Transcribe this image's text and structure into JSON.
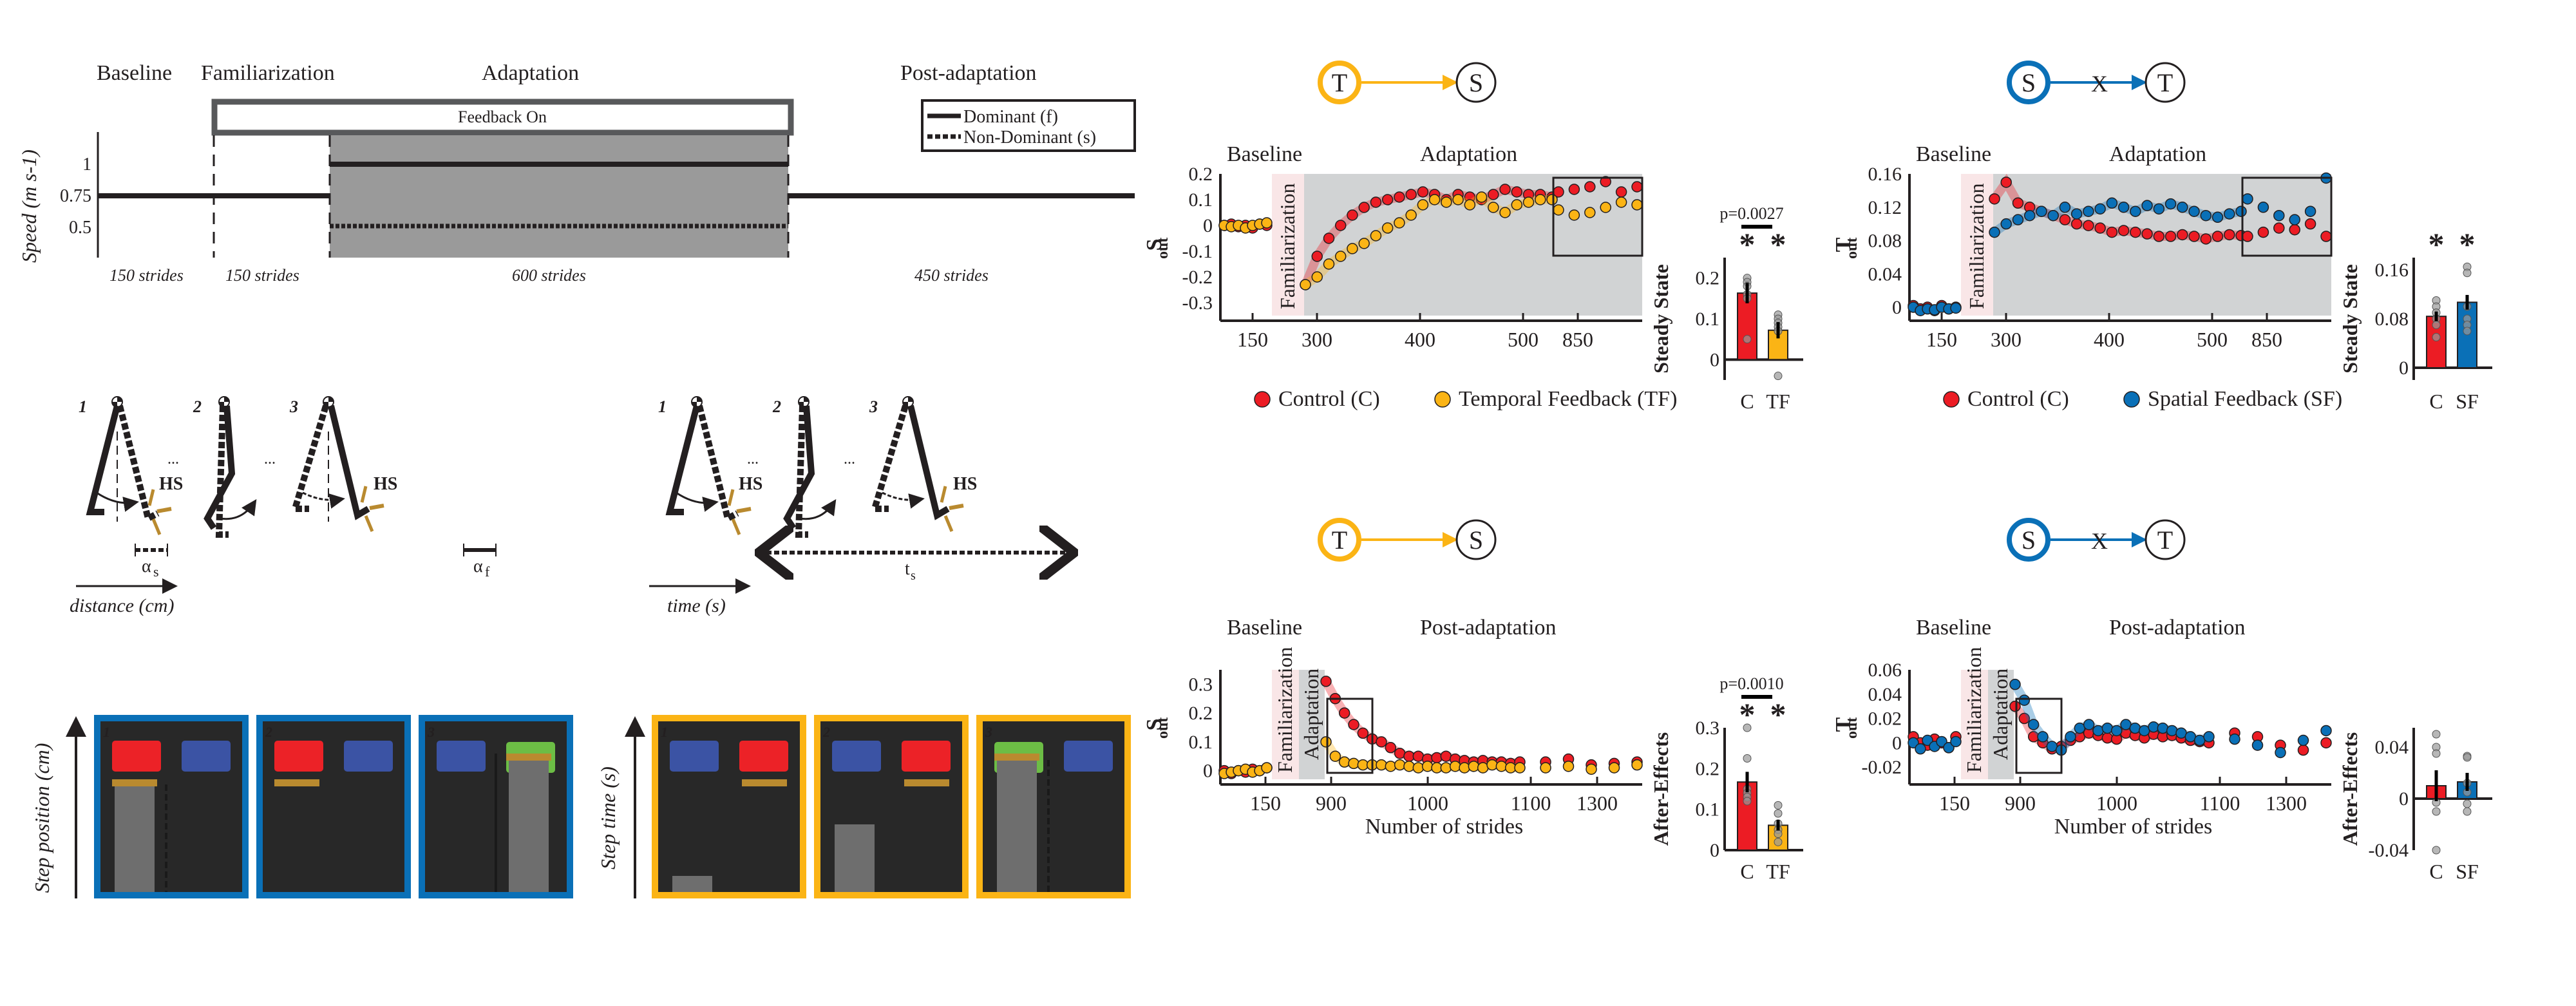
{
  "colors": {
    "control": "#ec1c24",
    "temporal": "#fbb415",
    "spatial": "#0a70b7",
    "hs": "#b98a2f",
    "familiarization_shade": "#f9e6e7",
    "adaptation_shade": "#d1d3d4",
    "screen_bg": "#282828",
    "screen_bar": "#6e6e6e",
    "target_red": "#ec2227",
    "target_blue": "#3b53a4",
    "target_green": "#6cbd45",
    "feedback_box_border": "#58595b",
    "protocol_gray": "#9a9a9a"
  },
  "protocol": {
    "phases": [
      "Baseline",
      "Familiarization",
      "Adaptation",
      "Post-adaptation"
    ],
    "feedback_label": "Feedback On",
    "ylabel": "Speed (m s-1)",
    "yticks": [
      "1",
      "0.75",
      "0.5"
    ],
    "durations": [
      "150 strides",
      "150 strides",
      "600 strides",
      "450 strides"
    ],
    "legend": [
      "Dominant (f)",
      "Non-Dominant (s)"
    ],
    "speeds": {
      "baseline": 0.75,
      "familiarization": 0.75,
      "adaptation_dominant": 1.0,
      "adaptation_nondominant": 0.5,
      "post_adaptation": 0.75
    }
  },
  "stick_spatial": {
    "frame_numbers": [
      "1",
      "2",
      "3"
    ],
    "ellipsis": "...",
    "hs_label": "HS",
    "alpha_s": "α",
    "alpha_s_sub": "s",
    "alpha_f": "α",
    "alpha_f_sub": "f",
    "axis_label": "distance (cm)"
  },
  "stick_temporal": {
    "frame_numbers": [
      "1",
      "2",
      "3"
    ],
    "ellipsis": "...",
    "hs_label": "HS",
    "ts": "t",
    "ts_sub": "s",
    "axis_label": "time (s)"
  },
  "screens_spatial": {
    "ylabel": "Step position (cm)",
    "frames": [
      "1",
      "2",
      "3"
    ]
  },
  "screens_temporal": {
    "ylabel": "Step time (s)",
    "frames": [
      "1",
      "2",
      "3"
    ]
  },
  "diagrams": {
    "ts": {
      "from": "T",
      "to": "S",
      "blocked": false
    },
    "st": {
      "from": "S",
      "to": "T",
      "blocked": true,
      "block_mark": "X"
    }
  },
  "chart_data": [
    {
      "id": "ts-adaptation",
      "type": "scatter",
      "title": "T → S",
      "phase_labels": [
        "Baseline",
        "Adaptation"
      ],
      "shaded_labels": [
        "Familiarization"
      ],
      "ylabel": "S",
      "ylabel_sub": "out",
      "ylim": [
        -0.35,
        0.2
      ],
      "yticks": [
        "0.2",
        "0.1",
        "0",
        "-0.1",
        "-0.2",
        "-0.3"
      ],
      "ytick_values": [
        0.2,
        0.1,
        0,
        -0.1,
        -0.2,
        -0.3
      ],
      "xticks": [
        "150",
        "300",
        "400",
        "500",
        "850"
      ],
      "series": [
        {
          "name": "Control (C)",
          "color_key": "control",
          "baseline": [
            0,
            0.005,
            -0.005,
            0,
            -0.01,
            0.005,
            0
          ],
          "adaptation": [
            -0.23,
            -0.12,
            -0.05,
            0.0,
            0.04,
            0.07,
            0.09,
            0.1,
            0.11,
            0.12,
            0.13,
            0.12,
            0.1,
            0.12,
            0.11,
            0.1,
            0.12,
            0.14,
            0.13,
            0.12,
            0.12,
            0.11
          ],
          "steady": [
            0.13,
            0.14,
            0.15,
            0.17,
            0.13,
            0.15
          ]
        },
        {
          "name": "Temporal Feedback (TF)",
          "color_key": "temporal",
          "baseline": [
            0,
            -0.005,
            0,
            -0.01,
            0,
            0.005,
            0.01
          ],
          "adaptation": [
            -0.23,
            -0.2,
            -0.15,
            -0.12,
            -0.09,
            -0.07,
            -0.04,
            -0.01,
            0.01,
            0.04,
            0.08,
            0.1,
            0.09,
            0.1,
            0.08,
            0.11,
            0.07,
            0.05,
            0.08,
            0.09,
            0.1,
            0.1
          ],
          "steady": [
            0.06,
            0.04,
            0.05,
            0.07,
            0.09,
            0.08
          ]
        }
      ],
      "bar": {
        "ylabel": "Steady State",
        "categories": [
          "C",
          "TF"
        ],
        "values": [
          0.163,
          0.072
        ],
        "errors": [
          0.025,
          0.02
        ],
        "ylim": [
          -0.05,
          0.25
        ],
        "yticks": [
          "0.2",
          "0.1",
          "0"
        ],
        "ytick_values": [
          0.2,
          0.1,
          0
        ],
        "points": [
          [
            0.2,
            0.19,
            0.18,
            0.16,
            0.15,
            0.05
          ],
          [
            0.11,
            0.1,
            0.09,
            0.08,
            0.07,
            -0.04
          ]
        ],
        "p_value": "p=0.0027",
        "stars": [
          "*",
          "*"
        ]
      },
      "legend": [
        "Control (C)",
        "Temporal Feedback (TF)"
      ]
    },
    {
      "id": "st-adaptation",
      "type": "scatter",
      "title": "S ✕→ T",
      "phase_labels": [
        "Baseline",
        "Adaptation"
      ],
      "shaded_labels": [
        "Familiarization"
      ],
      "ylabel": "T",
      "ylabel_sub": "out",
      "ylim": [
        -0.01,
        0.16
      ],
      "yticks": [
        "0.16",
        "0.12",
        "0.08",
        "0.04",
        "0"
      ],
      "ytick_values": [
        0.16,
        0.12,
        0.08,
        0.04,
        0
      ],
      "xticks": [
        "150",
        "300",
        "400",
        "500",
        "850"
      ],
      "series": [
        {
          "name": "Control (C)",
          "color_key": "control",
          "baseline": [
            0.002,
            -0.002,
            0,
            -0.004,
            0.002,
            -0.002,
            0
          ],
          "adaptation": [
            0.13,
            0.15,
            0.125,
            0.12,
            0.115,
            0.11,
            0.105,
            0.1,
            0.098,
            0.095,
            0.09,
            0.092,
            0.09,
            0.088,
            0.085,
            0.085,
            0.087,
            0.085,
            0.082,
            0.085,
            0.087,
            0.086
          ],
          "steady": [
            0.085,
            0.09,
            0.095,
            0.093,
            0.1,
            0.085
          ]
        },
        {
          "name": "Spatial Feedback (SF)",
          "color_key": "spatial",
          "baseline": [
            0,
            -0.004,
            -0.002,
            -0.003,
            0,
            -0.002,
            -0.001
          ],
          "adaptation": [
            0.09,
            0.1,
            0.105,
            0.11,
            0.115,
            0.11,
            0.12,
            0.112,
            0.115,
            0.118,
            0.125,
            0.12,
            0.115,
            0.122,
            0.118,
            0.124,
            0.12,
            0.115,
            0.11,
            0.108,
            0.112,
            0.115
          ],
          "steady": [
            0.13,
            0.12,
            0.11,
            0.105,
            0.115,
            0.155
          ]
        }
      ],
      "bar": {
        "ylabel": "Steady State",
        "categories": [
          "C",
          "SF"
        ],
        "values": [
          0.084,
          0.107
        ],
        "errors": [
          0.008,
          0.012
        ],
        "ylim": [
          -0.02,
          0.18
        ],
        "yticks": [
          "0.16",
          "0.08",
          "0"
        ],
        "ytick_values": [
          0.16,
          0.08,
          0
        ],
        "points": [
          [
            0.11,
            0.1,
            0.09,
            0.08,
            0.07,
            0.05
          ],
          [
            0.165,
            0.155,
            0.1,
            0.08,
            0.07,
            0.06
          ]
        ],
        "p_value": "",
        "stars": [
          "*",
          "*"
        ]
      },
      "legend": [
        "Control (C)",
        "Spatial Feedback (SF)"
      ]
    },
    {
      "id": "ts-post",
      "type": "scatter",
      "title": "T → S",
      "phase_labels": [
        "Baseline",
        "Post-adaptation"
      ],
      "shaded_labels": [
        "Familiarization",
        "Adaptation"
      ],
      "ylabel": "S",
      "ylabel_sub": "out",
      "xlabel": "Number of strides",
      "ylim": [
        -0.03,
        0.35
      ],
      "yticks": [
        "0.3",
        "0.2",
        "0.1",
        "0"
      ],
      "ytick_values": [
        0.3,
        0.2,
        0.1,
        0
      ],
      "xticks": [
        "150",
        "900",
        "1000",
        "1100",
        "1300"
      ],
      "series": [
        {
          "name": "Control (C)",
          "color_key": "control",
          "baseline": [
            0,
            -0.01,
            0,
            -0.005,
            0.005,
            0,
            0.01
          ],
          "post": [
            0.31,
            0.25,
            0.2,
            0.16,
            0.13,
            0.11,
            0.1,
            0.08,
            0.06,
            0.05,
            0.05,
            0.04,
            0.045,
            0.05,
            0.04,
            0.035,
            0.03,
            0.035,
            0.03,
            0.03,
            0.025,
            0.03
          ],
          "late": [
            0.03,
            0.04,
            0.02,
            0.025,
            0.03
          ]
        },
        {
          "name": "Temporal Feedback (TF)",
          "color_key": "temporal",
          "baseline": [
            -0.01,
            -0.005,
            0,
            0.005,
            -0.005,
            0,
            0.01
          ],
          "post": [
            0.1,
            0.05,
            0.03,
            0.025,
            0.02,
            0.02,
            0.02,
            0.015,
            0.02,
            0.015,
            0.01,
            0.015,
            0.01,
            0.01,
            0.015,
            0.01,
            0.015,
            0.01,
            0.02,
            0.015,
            0.01,
            0.01
          ],
          "late": [
            0.01,
            0.015,
            0.005,
            0.01,
            0.02
          ]
        }
      ],
      "bar": {
        "ylabel": "After-Effects",
        "categories": [
          "C",
          "TF"
        ],
        "values": [
          0.167,
          0.061
        ],
        "errors": [
          0.025,
          0.013
        ],
        "ylim": [
          0,
          0.3
        ],
        "yticks": [
          "0.3",
          "0.2",
          "0.1",
          "0"
        ],
        "ytick_values": [
          0.3,
          0.2,
          0.1,
          0
        ],
        "points": [
          [
            0.3,
            0.225,
            0.15,
            0.14,
            0.13,
            0.12
          ],
          [
            0.11,
            0.09,
            0.065,
            0.05,
            0.04,
            0.02
          ]
        ],
        "p_value": "p=0.0010",
        "stars": [
          "*",
          "*"
        ]
      }
    },
    {
      "id": "st-post",
      "type": "scatter",
      "title": "S ✕→ T",
      "phase_labels": [
        "Baseline",
        "Post-adaptation"
      ],
      "shaded_labels": [
        "Familiarization",
        "Adaptation"
      ],
      "ylabel": "T",
      "ylabel_sub": "out",
      "xlabel": "Number of strides",
      "ylim": [
        -0.03,
        0.06
      ],
      "yticks": [
        "0.06",
        "0.04",
        "0.02",
        "0",
        "-0.02"
      ],
      "ytick_values": [
        0.06,
        0.04,
        0.02,
        0,
        -0.02
      ],
      "xticks": [
        "150",
        "900",
        "1000",
        "1100",
        "1300"
      ],
      "series": [
        {
          "name": "Control (C)",
          "color_key": "control",
          "baseline": [
            0.005,
            0,
            -0.002,
            0.003,
            0,
            -0.004,
            0.005
          ],
          "post": [
            0.03,
            0.02,
            0.005,
            0,
            -0.005,
            -0.003,
            0.002,
            0.005,
            0.008,
            0.006,
            0.004,
            0.003,
            0.008,
            0.006,
            0.004,
            0.007,
            0.005,
            0.006,
            0.004,
            0.002,
            0.001,
            0.0
          ],
          "late": [
            0.008,
            0.005,
            -0.002,
            -0.006,
            0.0
          ]
        },
        {
          "name": "Spatial Feedback (SF)",
          "color_key": "spatial",
          "baseline": [
            0,
            -0.005,
            0.002,
            -0.003,
            0.001,
            -0.004,
            0.001
          ],
          "post": [
            0.048,
            0.035,
            0.015,
            0.005,
            -0.003,
            -0.006,
            0.005,
            0.012,
            0.015,
            0.01,
            0.012,
            0.01,
            0.015,
            0.012,
            0.01,
            0.013,
            0.012,
            0.01,
            0.008,
            0.005,
            0.002,
            0.005
          ],
          "late": [
            0.003,
            -0.002,
            -0.008,
            0.002,
            0.01
          ]
        }
      ],
      "bar": {
        "ylabel": "After-Effects",
        "categories": [
          "C",
          "SF"
        ],
        "values": [
          0.01,
          0.013
        ],
        "errors": [
          0.012,
          0.007
        ],
        "ylim": [
          -0.04,
          0.055
        ],
        "yticks": [
          "0.04",
          "0",
          "-0.04"
        ],
        "ytick_values": [
          0.04,
          0,
          -0.04
        ],
        "points": [
          [
            0.05,
            0.04,
            0.035,
            -0.003,
            -0.01,
            -0.04
          ],
          [
            0.033,
            0.032,
            0.012,
            0.005,
            -0.004,
            -0.01
          ]
        ],
        "p_value": "",
        "stars": []
      }
    }
  ]
}
